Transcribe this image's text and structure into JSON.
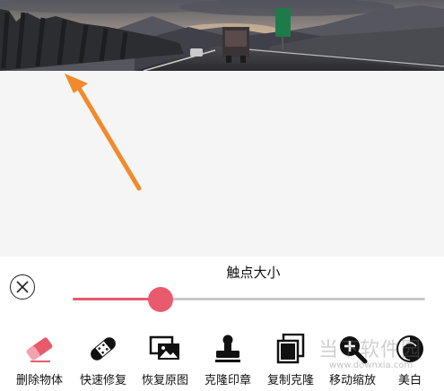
{
  "size_control": {
    "label": "触点大小",
    "value_fraction": 0.25
  },
  "toolbar": {
    "items": [
      {
        "label": "删除物体",
        "icon": "eraser-icon",
        "active": true
      },
      {
        "label": "快速修复",
        "icon": "bandage-icon",
        "active": false
      },
      {
        "label": "恢复原图",
        "icon": "restore-image-icon",
        "active": false
      },
      {
        "label": "克隆印章",
        "icon": "clone-stamp-icon",
        "active": false
      },
      {
        "label": "复制克隆",
        "icon": "copy-clone-icon",
        "active": false
      },
      {
        "label": "移动缩放",
        "icon": "zoom-move-icon",
        "active": false
      },
      {
        "label": "美白",
        "icon": "whiten-icon",
        "active": false
      }
    ]
  },
  "watermark": {
    "text": "当下软件园",
    "url": "www.downxia.com"
  },
  "colors": {
    "accent": "#e85a6c",
    "annotation_arrow": "#f08a2c"
  }
}
